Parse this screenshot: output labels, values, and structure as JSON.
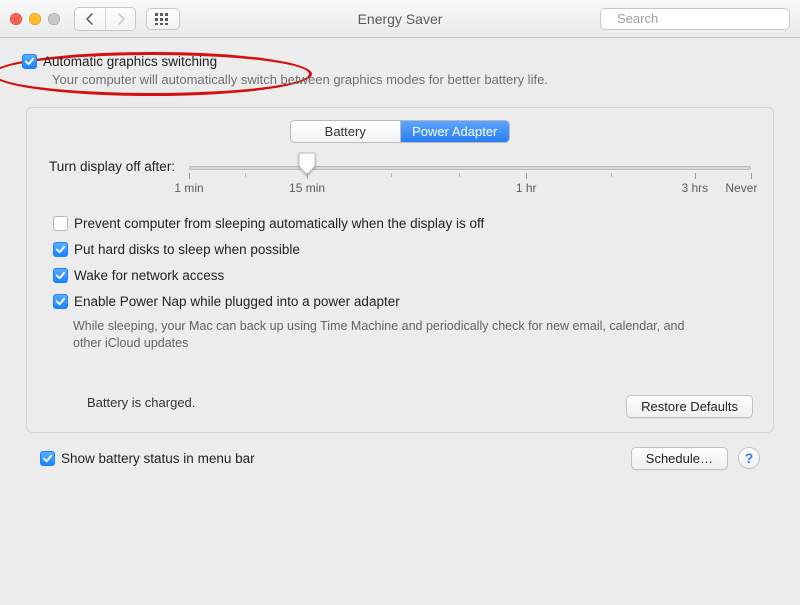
{
  "window": {
    "title": "Energy Saver",
    "search_placeholder": "Search"
  },
  "auto_gfx": {
    "label": "Automatic graphics switching",
    "checked": true,
    "helper": "Your computer will automatically switch between graphics modes for better battery life."
  },
  "tabs": {
    "battery": "Battery",
    "power_adapter": "Power Adapter",
    "active": "power_adapter"
  },
  "slider": {
    "label": "Turn display off after:",
    "ticks": [
      "1 min",
      "15 min",
      "1 hr",
      "3 hrs",
      "Never"
    ]
  },
  "options": {
    "prevent_sleep": {
      "label": "Prevent computer from sleeping automatically when the display is off",
      "checked": false
    },
    "hd_sleep": {
      "label": "Put hard disks to sleep when possible",
      "checked": true
    },
    "wake_network": {
      "label": "Wake for network access",
      "checked": true
    },
    "power_nap": {
      "label": "Enable Power Nap while plugged into a power adapter",
      "checked": true
    },
    "power_nap_helper": "While sleeping, your Mac can back up using Time Machine and periodically check for new email, calendar, and other iCloud updates"
  },
  "battery_status": "Battery is charged.",
  "buttons": {
    "restore": "Restore Defaults",
    "schedule": "Schedule…"
  },
  "footer": {
    "show_status_label": "Show battery status in menu bar",
    "show_status_checked": true
  },
  "help_glyph": "?"
}
